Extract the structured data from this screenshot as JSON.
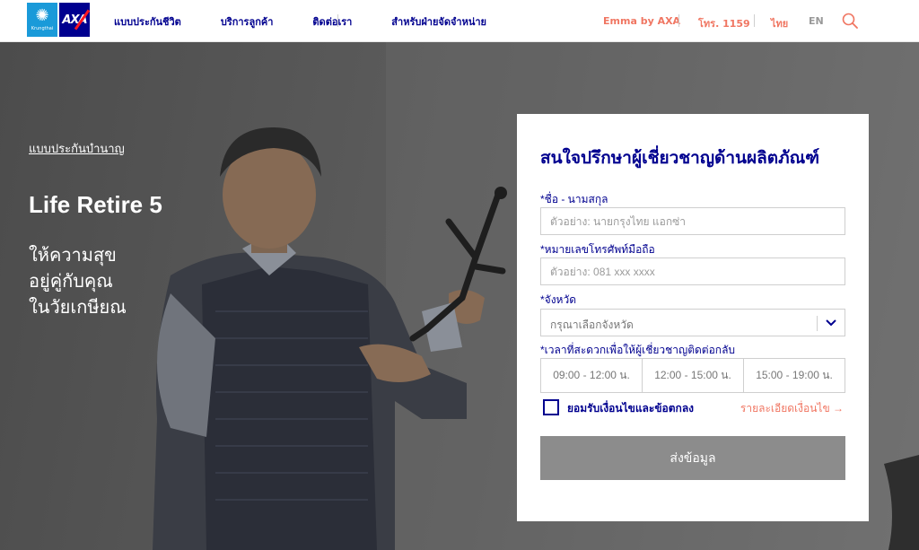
{
  "header": {
    "logo_ktb_text": "Krungthai",
    "logo_axa_text": "AXA",
    "nav": [
      "แบบประกันชีวิต",
      "บริการลูกค้า",
      "ติดต่อเรา",
      "สำหรับฝ่ายจัดจำหน่าย"
    ],
    "emma": "Emma by AXA",
    "phone": "โทร. 1159",
    "lang_th": "ไทย",
    "lang_en": "EN"
  },
  "hero": {
    "breadcrumb": "แบบประกันบำนาญ",
    "product_title": "Life Retire 5",
    "tagline": [
      "ให้ความสุข",
      "อยู่คู่กับคุณ",
      "ในวัยเกษียณ"
    ]
  },
  "form": {
    "title": "สนใจปรึกษาผู้เชี่ยวชาญด้านผลิตภัณฑ์",
    "name_label": "*ชื่อ - นามสกุล",
    "name_placeholder": "ตัวอย่าง: นายกรุงไทย แอกซ่า",
    "phone_label": "*หมายเลขโทรศัพท์มือถือ",
    "phone_placeholder": "ตัวอย่าง: 081 xxx xxxx",
    "province_label": "*จังหวัด",
    "province_value": "กรุณาเลือกจังหวัด",
    "time_label": "*เวลาที่สะดวกเพื่อให้ผู้เชี่ยวชาญติดต่อกลับ",
    "time_slots": [
      "09:00 - 12:00 น.",
      "12:00 - 15:00 น.",
      "15:00 - 19:00 น."
    ],
    "consent_label": "ยอมรับเงื่อนไขและข้อตกลง",
    "terms_link": "รายละเอียดเงื่อนไข",
    "submit_label": "ส่งข้อมูล"
  },
  "colors": {
    "brand_blue": "#00008f",
    "accent_red": "#f07662",
    "button_gray": "#8c8c8c"
  }
}
